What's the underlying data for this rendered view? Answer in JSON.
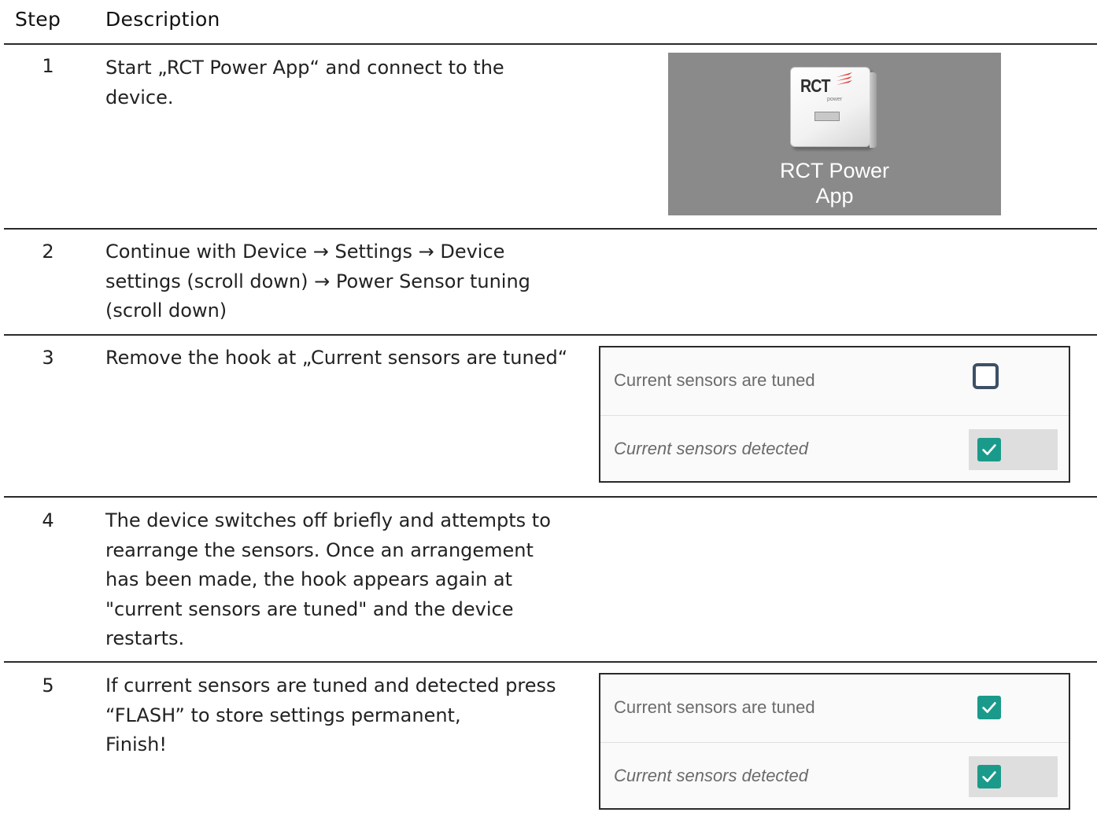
{
  "table": {
    "headers": {
      "step": "Step",
      "description": "Description"
    },
    "rows": [
      {
        "step": "1",
        "description": "Start „RCT Power App“ and connect to the\ndevice."
      },
      {
        "step": "2",
        "description": "Continue with Device → Settings → Device\nsettings (scroll down) → Power Sensor tuning\n(scroll down)"
      },
      {
        "step": "3",
        "description": "Remove the hook at „Current sensors are tuned“"
      },
      {
        "step": "4",
        "description": "The device switches off briefly and attempts to\nrearrange the sensors. Once an arrangement\nhas been made, the hook appears again at\n\"current sensors are tuned\" and the device\nrestarts."
      },
      {
        "step": "5",
        "description": "If current sensors are tuned and detected press\n“FLASH” to store settings permanent,\nFinish!"
      }
    ]
  },
  "app_tile": {
    "label": "RCT Power\nApp",
    "logo": "RCT",
    "logo_sub": "power",
    "background": "#8a8a8a"
  },
  "panels": {
    "step3": {
      "tuned_label": "Current sensors are tuned",
      "tuned_checked": false,
      "detected_label": "Current sensors detected",
      "detected_checked": true
    },
    "step5": {
      "tuned_label": "Current sensors are tuned",
      "tuned_checked": true,
      "detected_label": "Current sensors detected",
      "detected_checked": true
    }
  },
  "colors": {
    "checkbox_checked": "#1a9a8a",
    "checkbox_unchecked_border": "#3d5066",
    "rule": "#2a2a2a"
  }
}
